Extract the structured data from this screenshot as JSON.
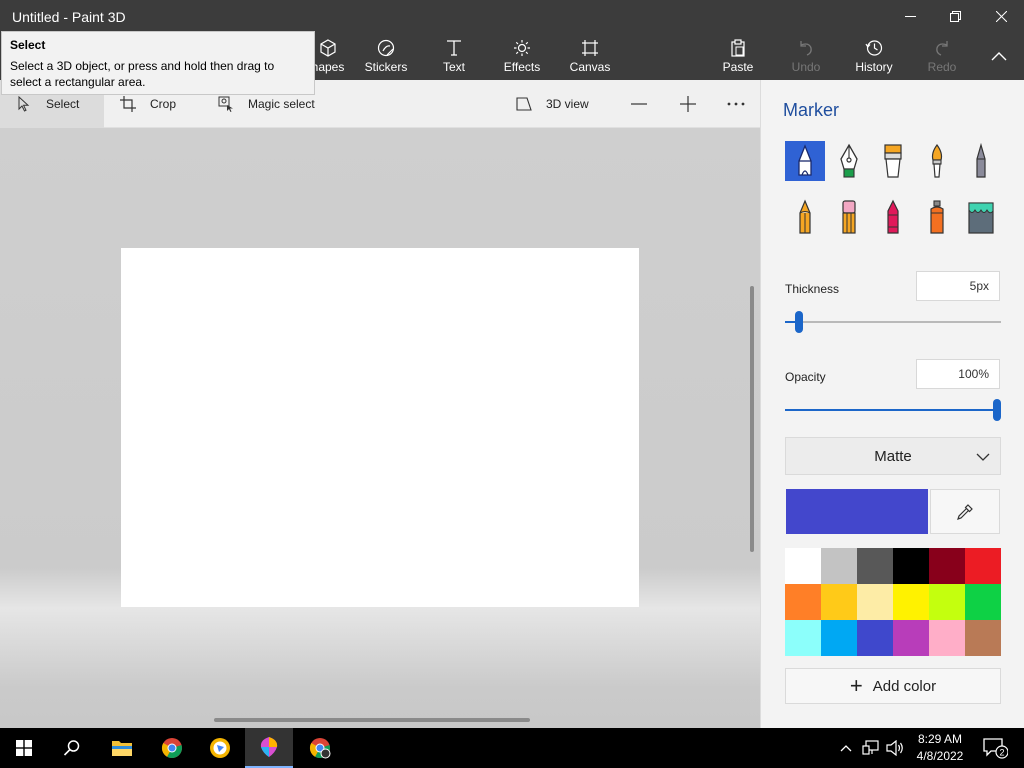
{
  "window": {
    "title": "Untitled - Paint 3D"
  },
  "ribbon": {
    "items": [
      {
        "label": "hapes",
        "icon": "cube-icon"
      },
      {
        "label": "Stickers",
        "icon": "sticker-icon"
      },
      {
        "label": "Text",
        "icon": "text-icon"
      },
      {
        "label": "Effects",
        "icon": "effects-icon"
      },
      {
        "label": "Canvas",
        "icon": "canvas-icon"
      }
    ],
    "actions": [
      {
        "label": "Paste",
        "icon": "paste-icon",
        "enabled": true
      },
      {
        "label": "Undo",
        "icon": "undo-icon",
        "enabled": false
      },
      {
        "label": "History",
        "icon": "history-icon",
        "enabled": true
      },
      {
        "label": "Redo",
        "icon": "redo-icon",
        "enabled": false
      }
    ]
  },
  "tooltip": {
    "title": "Select",
    "body": "Select a 3D object, or press and hold then drag to select a rectangular area."
  },
  "toolbar": {
    "select": "Select",
    "crop": "Crop",
    "magic_select": "Magic select",
    "view_3d": "3D view"
  },
  "panel": {
    "title": "Marker",
    "brushes": [
      {
        "name": "marker-tool",
        "selected": true
      },
      {
        "name": "calligraphy-pen-tool",
        "selected": false
      },
      {
        "name": "oil-brush-tool",
        "selected": false
      },
      {
        "name": "watercolor-tool",
        "selected": false
      },
      {
        "name": "pixel-pen-tool",
        "selected": false
      },
      {
        "name": "pencil-tool",
        "selected": false
      },
      {
        "name": "eraser-tool",
        "selected": false
      },
      {
        "name": "crayon-tool",
        "selected": false
      },
      {
        "name": "spray-can-tool",
        "selected": false
      },
      {
        "name": "fill-tool",
        "selected": false
      }
    ],
    "thickness": {
      "label": "Thickness",
      "value": "5px",
      "fraction": 0.05
    },
    "opacity": {
      "label": "Opacity",
      "value": "100%",
      "fraction": 1.0
    },
    "finish": {
      "selected": "Matte"
    },
    "current_color": "#4347cc",
    "palette": [
      "#ffffff",
      "#c3c3c3",
      "#585858",
      "#000000",
      "#88001b",
      "#ec1c24",
      "#ff7f27",
      "#ffca18",
      "#fdeca6",
      "#fff200",
      "#c4ff0e",
      "#0ed145",
      "#8cfffb",
      "#00a8f3",
      "#3f48cc",
      "#b83dba",
      "#ffaec8",
      "#b97a56"
    ],
    "add_color": "Add color"
  },
  "taskbar": {
    "time": "8:29 AM",
    "date": "4/8/2022",
    "notifications": "2"
  }
}
